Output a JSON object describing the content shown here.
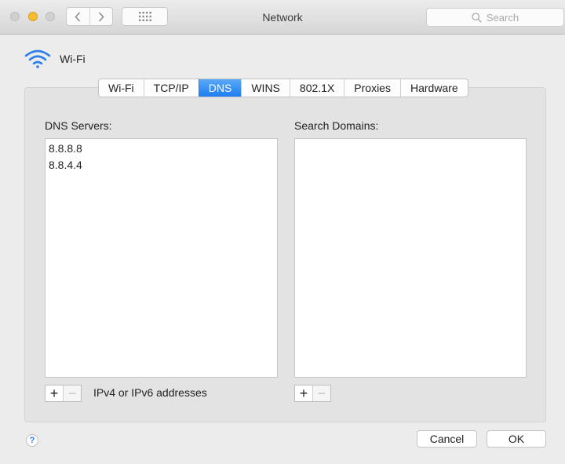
{
  "window": {
    "title": "Network"
  },
  "toolbar": {
    "back_icon": "chevron-left-icon",
    "forward_icon": "chevron-right-icon",
    "grid_icon": "grid-icon",
    "search": {
      "placeholder": "Search",
      "icon": "search-icon"
    }
  },
  "header": {
    "interface_name": "Wi-Fi",
    "icon": "wifi-icon",
    "icon_color": "#2b7de9"
  },
  "tabs": [
    {
      "label": "Wi-Fi",
      "active": false
    },
    {
      "label": "TCP/IP",
      "active": false
    },
    {
      "label": "DNS",
      "active": true
    },
    {
      "label": "WINS",
      "active": false
    },
    {
      "label": "802.1X",
      "active": false
    },
    {
      "label": "Proxies",
      "active": false
    },
    {
      "label": "Hardware",
      "active": false
    }
  ],
  "dns": {
    "servers_label": "DNS Servers:",
    "servers": [
      "8.8.8.8",
      "8.8.4.4"
    ],
    "hint": "IPv4 or IPv6 addresses",
    "add_label": "+",
    "remove_label": "−"
  },
  "search_domains": {
    "label": "Search Domains:",
    "items": [],
    "add_label": "+",
    "remove_label": "−"
  },
  "footer": {
    "help_label": "?",
    "cancel_label": "Cancel",
    "ok_label": "OK"
  },
  "colors": {
    "accent": "#1d7ef0",
    "window_bg": "#ececec",
    "panel_bg": "#e3e3e3"
  }
}
